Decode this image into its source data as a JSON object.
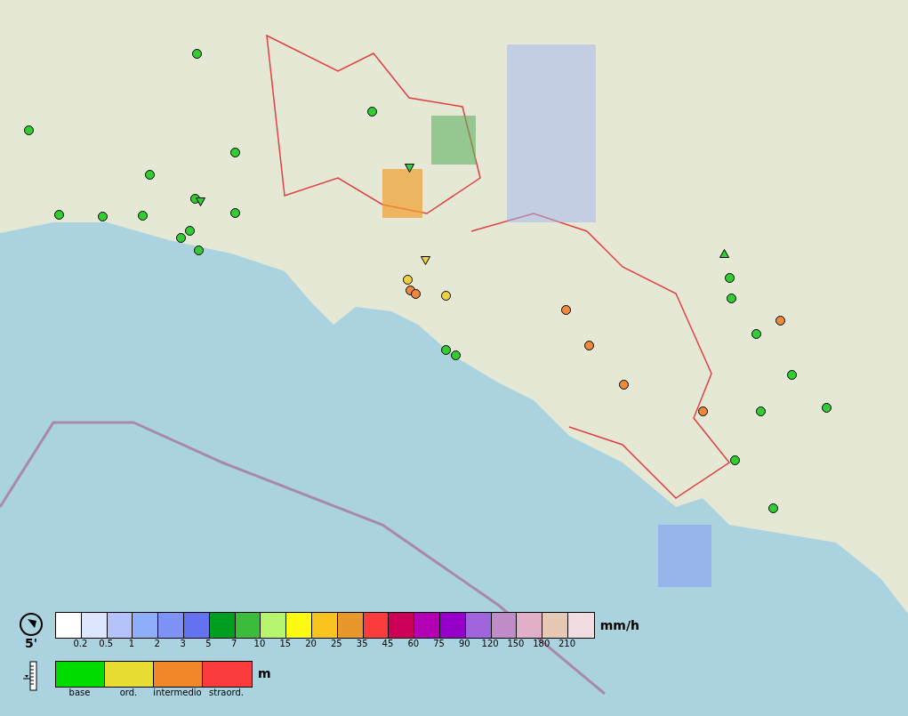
{
  "stations": [
    {
      "kind": "circle",
      "color": "#33cc33"
    },
    {
      "kind": "circle",
      "color": "#33cc33"
    },
    {
      "kind": "circle",
      "color": "#33cc33"
    },
    {
      "kind": "circle",
      "color": "#33cc33"
    },
    {
      "kind": "circle",
      "color": "#33cc33"
    },
    {
      "kind": "circle",
      "color": "#33cc33"
    },
    {
      "kind": "circle",
      "color": "#33cc33"
    },
    {
      "kind": "circle",
      "color": "#33cc33"
    },
    {
      "kind": "circle",
      "color": "#33cc33"
    },
    {
      "kind": "circle",
      "color": "#33cc33"
    },
    {
      "kind": "circle",
      "color": "#33cc33"
    },
    {
      "kind": "circle",
      "color": "#33cc33"
    },
    {
      "kind": "circle",
      "color": "#33cc33"
    },
    {
      "kind": "circle",
      "color": "#33cc33"
    },
    {
      "kind": "circle",
      "color": "#33cc33"
    },
    {
      "kind": "circle",
      "color": "#33cc33"
    },
    {
      "kind": "circle",
      "color": "#33cc33"
    },
    {
      "kind": "circle",
      "color": "#33cc33"
    },
    {
      "kind": "circle",
      "color": "#33cc33"
    },
    {
      "kind": "circle",
      "color": "#33cc33"
    },
    {
      "kind": "circle",
      "color": "#33cc33"
    },
    {
      "kind": "circle",
      "color": "#33cc33"
    },
    {
      "kind": "circle",
      "color": "#33cc33"
    },
    {
      "kind": "circle",
      "color": "#f0d040"
    },
    {
      "kind": "circle",
      "color": "#f0d040"
    },
    {
      "kind": "circle",
      "color": "#f08a3a"
    },
    {
      "kind": "circle",
      "color": "#f08a3a"
    },
    {
      "kind": "circle",
      "color": "#f08a3a"
    },
    {
      "kind": "circle",
      "color": "#f08a3a"
    },
    {
      "kind": "circle",
      "color": "#f08a3a"
    },
    {
      "kind": "circle",
      "color": "#f08a3a"
    },
    {
      "kind": "circle",
      "color": "#f08a3a"
    },
    {
      "kind": "triangle-down",
      "color": "#33cc33"
    },
    {
      "kind": "triangle-down",
      "color": "#33cc33"
    },
    {
      "kind": "triangle-down",
      "color": "#f0d040"
    },
    {
      "kind": "triangle-up",
      "color": "#33cc33"
    }
  ],
  "rain_legend": {
    "interval": "5'",
    "unit": "mm/h",
    "cells": [
      {
        "color": "#ffffff"
      },
      {
        "color": "#dde6ff"
      },
      {
        "color": "#b4c4fb"
      },
      {
        "color": "#8eaef8"
      },
      {
        "color": "#7e93f5"
      },
      {
        "color": "#6272f0"
      },
      {
        "color": "#009e20"
      },
      {
        "color": "#3cbc3c"
      },
      {
        "color": "#b6f46e"
      },
      {
        "color": "#fffa14"
      },
      {
        "color": "#f9c31e"
      },
      {
        "color": "#e8972a"
      },
      {
        "color": "#fa3c3c"
      },
      {
        "color": "#cc0056"
      },
      {
        "color": "#b400b4"
      },
      {
        "color": "#9600c8"
      },
      {
        "color": "#a064dc"
      },
      {
        "color": "#c08cc8"
      },
      {
        "color": "#e1afc8"
      },
      {
        "color": "#e6c8b4"
      },
      {
        "color": "#f0dce1"
      }
    ],
    "ticks": [
      "0.2",
      "0.5",
      "1",
      "2",
      "3",
      "5",
      "7",
      "10",
      "15",
      "20",
      "25",
      "35",
      "45",
      "60",
      "75",
      "90",
      "120",
      "150",
      "180",
      "210"
    ]
  },
  "level_legend": {
    "unit": "m",
    "cells": [
      {
        "color": "#00dc00",
        "label": "base"
      },
      {
        "color": "#e6dc32",
        "label": "ord."
      },
      {
        "color": "#f0872a",
        "label": "intermedio"
      },
      {
        "color": "#fa3c3c",
        "label": "straord."
      }
    ]
  }
}
